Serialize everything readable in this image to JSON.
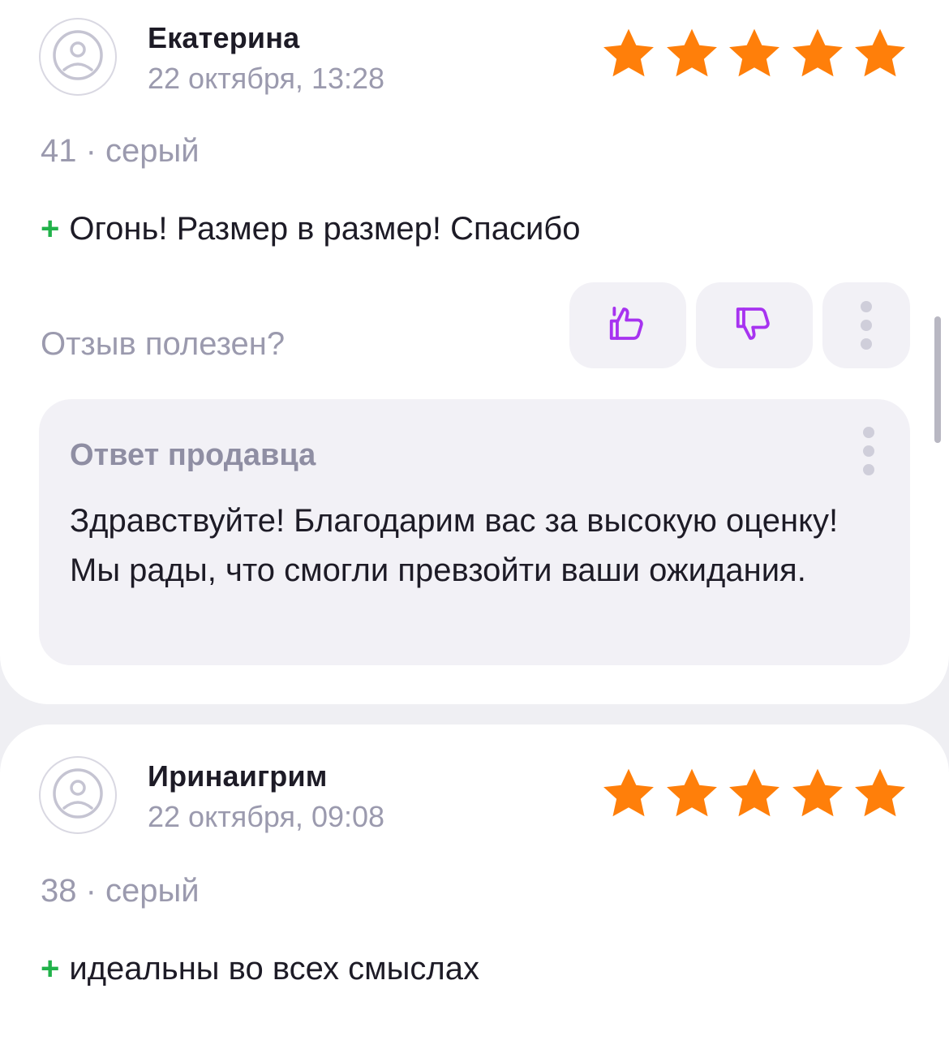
{
  "colors": {
    "star": "#ff7f0a",
    "plus": "#21b24a",
    "vote_icon": "#a733f0",
    "muted_text": "#9b9aae"
  },
  "reviews": [
    {
      "author": "Екатерина",
      "date": "22 октября, 13:28",
      "rating": 5,
      "size_color": "41 · серый",
      "pro_sign": "+",
      "pro_text": "Огонь! Размер в размер! Спасибо",
      "helpful_label": "Отзыв полезен?",
      "seller_reply": {
        "title": "Ответ продавца",
        "text": "Здравствуйте! Благодарим вас за высокую оценку! Мы рады, что смогли превзойти ваши ожидания."
      }
    },
    {
      "author": "Иринаигрим",
      "date": "22 октября, 09:08",
      "rating": 5,
      "size_color": "38 · серый",
      "pro_sign": "+",
      "pro_text": "идеальны во всех смыслах"
    }
  ],
  "icons": {
    "avatar": "sad-face-icon",
    "star": "star-icon",
    "like": "thumbs-up-icon",
    "dislike": "thumbs-down-icon",
    "more": "more-vertical-icon"
  }
}
